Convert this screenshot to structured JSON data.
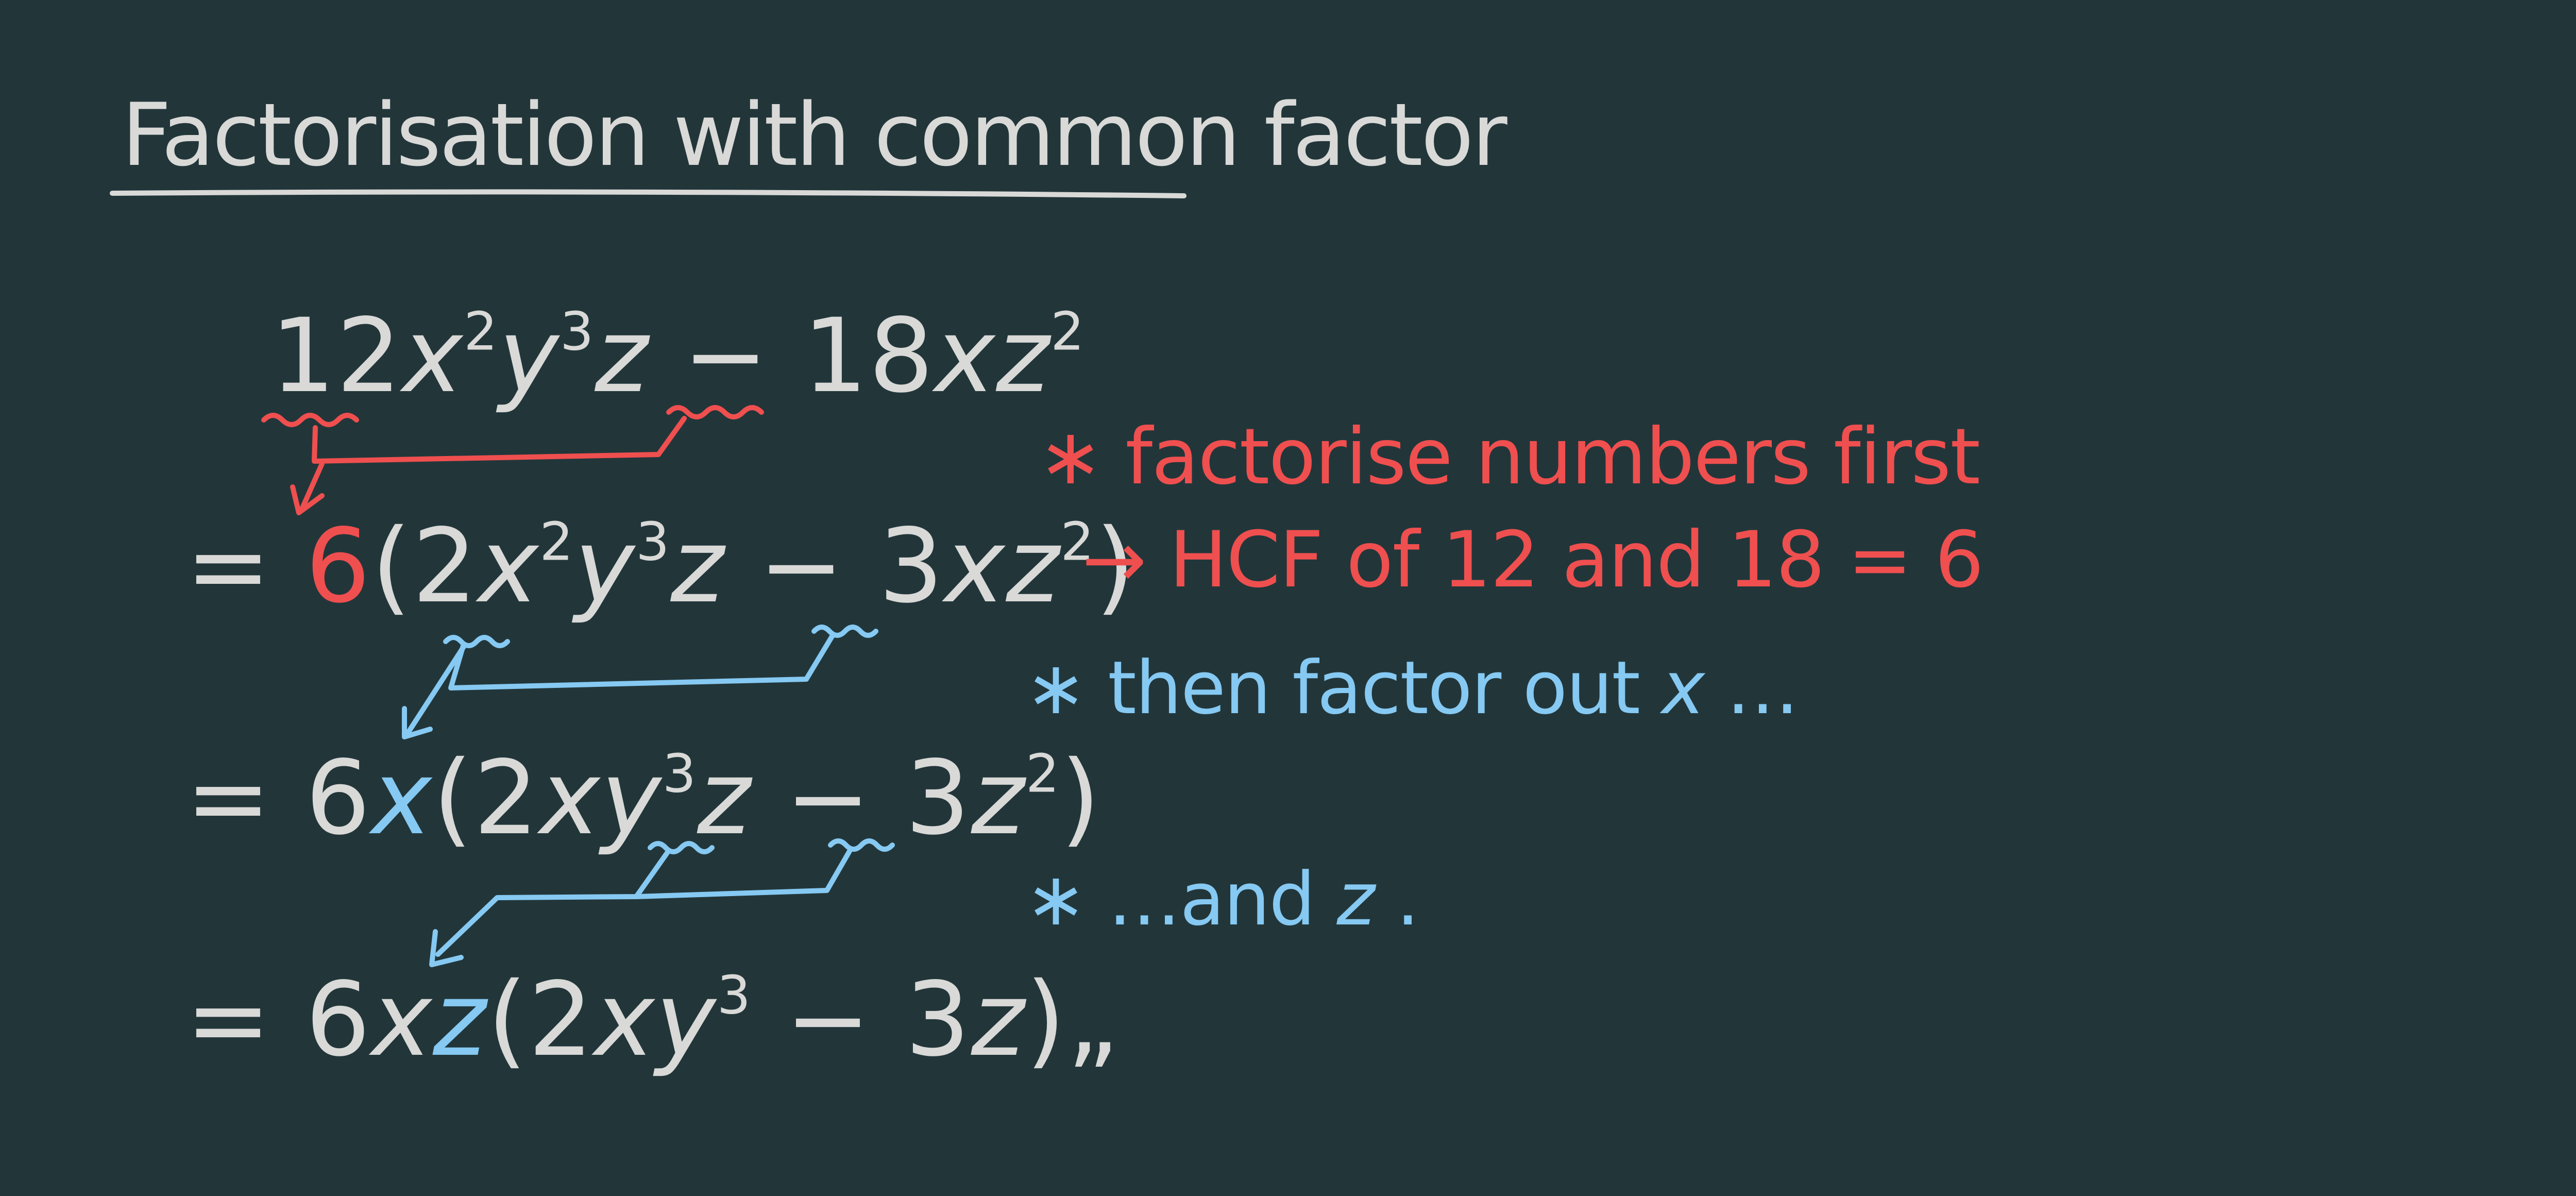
{
  "title": "Factorisation with common factor",
  "colors": {
    "background": "#22363a",
    "chalk_white": "#d9d9d7",
    "red": "#ef4f4f",
    "blue": "#86c9f2"
  },
  "steps": {
    "line1": {
      "c1": "12",
      "x": "x",
      "e2": "2",
      "y": "y",
      "e3": "3",
      "z": "z",
      "minus": " − ",
      "c2": "18",
      "xz": "xz",
      "e4": "2"
    },
    "line2": {
      "eq": "=",
      "six": "6",
      "open": "(",
      "a": "2",
      "x": "x",
      "e2": "2",
      "y": "y",
      "e3": "3",
      "z": "z",
      "minus": " − ",
      "b": "3",
      "xz": "xz",
      "e4": "2",
      "close": ")"
    },
    "line3": {
      "eq": "=",
      "six": "6",
      "x": "x",
      "open": "(",
      "a": "2",
      "xy": "xy",
      "e3": "3",
      "z": "z",
      "minus": " − ",
      "b": "3",
      "z2": "z",
      "e4": "2",
      "close": ")"
    },
    "line4": {
      "eq": "=",
      "six": "6",
      "x": "x",
      "z": "z",
      "open": "(",
      "a": "2",
      "xy": "xy",
      "e3": "3",
      "minus": " − ",
      "b": "3",
      "z2": "z",
      "close": ")",
      "end_mark": "„"
    }
  },
  "notes": {
    "note1": {
      "star": "∗",
      "text": "factorise numbers first"
    },
    "note2": {
      "arrow": "→",
      "text": "HCF of 12 and 18 = 6"
    },
    "note3": {
      "star": "∗",
      "text": "then factor out",
      "var": "x",
      "dots": " …"
    },
    "note4": {
      "star": "∗",
      "text": "…and",
      "var": "z",
      "dot": " ."
    }
  }
}
